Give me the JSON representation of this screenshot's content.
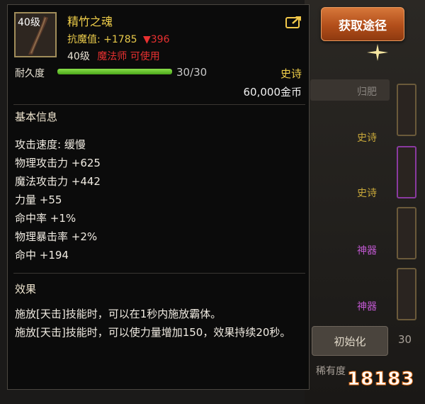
{
  "item": {
    "level_badge": "40级",
    "name": "精竹之魂",
    "magic_defense_label": "抗魔值:",
    "magic_defense_value": "+1785",
    "magic_defense_diff": "▼396",
    "level_requirement": "40级",
    "class_requirement": "魔法师 可使用",
    "durability_label": "耐久度",
    "durability_value": "30/30",
    "durability_fraction": 1.0,
    "rarity": "史诗",
    "price": "60,000金币"
  },
  "sections": {
    "basic_info": "基本信息",
    "effect": "效果"
  },
  "stats": [
    "攻击速度: 缓慢",
    "物理攻击力 +625",
    "魔法攻击力 +442",
    "力量 +55",
    "命中率 +1%",
    "物理暴击率 +2%",
    "命中 +194"
  ],
  "effects": [
    "施放[天击]技能时，可以在1秒内施放霸体。",
    "施放[天击]技能时，可以使力量增加150，效果持续20秒。"
  ],
  "side_panel": {
    "acquire_button": "获取途径",
    "labels": [
      "归肥",
      "史诗",
      "史诗",
      "神器",
      "神器"
    ],
    "init_button": "初始化",
    "bottom_label": "稀有度",
    "partial_number": "30"
  },
  "watermark": "18183",
  "colors": {
    "rarity_epic": "#f2d04a",
    "rarity_artifact": "#c058d0",
    "accent_orange": "#c4622a",
    "durability_green": "#6ccf35",
    "warn_red": "#e83030"
  }
}
